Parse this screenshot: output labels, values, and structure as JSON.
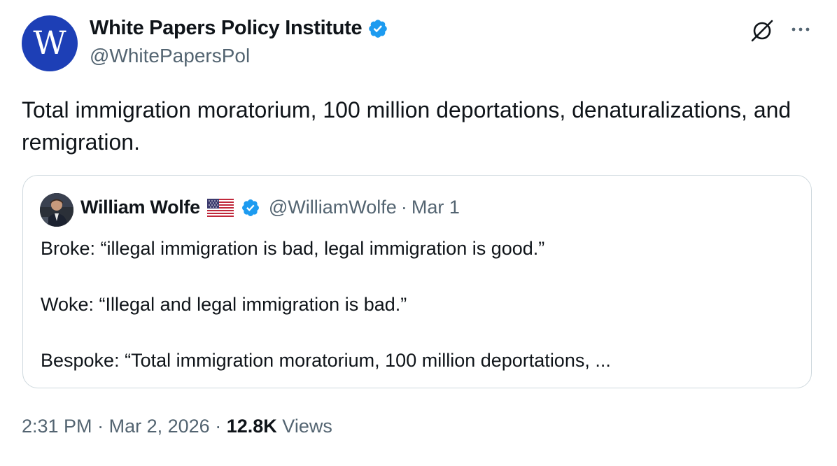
{
  "author": {
    "name": "White Papers Policy Institute",
    "handle": "@WhitePapersPol",
    "avatar_letter": "W",
    "avatar_color": "#1d3fb6",
    "verified": true
  },
  "header_actions": {
    "grok_icon": "grok-slash-circle-icon",
    "more_label": "···"
  },
  "tweet": {
    "text": "Total immigration moratorium, 100 million deportations, denaturalizations, and remigration."
  },
  "quote": {
    "name": "William Wolfe",
    "flag": "us-flag-icon",
    "verified": true,
    "handle": "@WilliamWolfe",
    "separator": "·",
    "date": "Mar 1",
    "lines": [
      "Broke: “illegal immigration is bad, legal immigration is good.”",
      "Woke: “Illegal and legal immigration is bad.”",
      "Bespoke: “Total immigration moratorium, 100 million deportations, ..."
    ]
  },
  "meta": {
    "time": "2:31 PM",
    "separator": "·",
    "date": "Mar 2, 2026",
    "views_count": "12.8K",
    "views_label": "Views"
  },
  "colors": {
    "verified_blue": "#1d9bf0",
    "secondary_text": "#536471",
    "border": "#cfd9de"
  }
}
